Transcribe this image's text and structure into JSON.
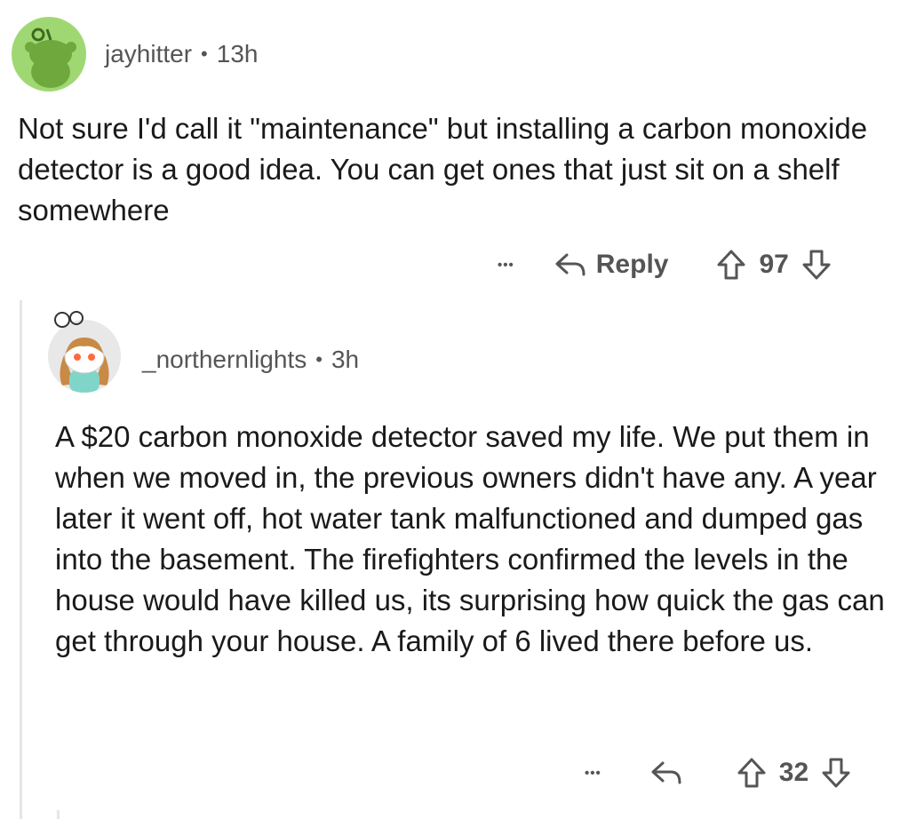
{
  "comments": [
    {
      "username": "jayhitter",
      "separator": "•",
      "age": "13h",
      "text": "Not sure I'd call it \"maintenance\" but installing a carbon monoxide detector is a good idea. You can get ones that just sit on a shelf somewhere",
      "more_label": "•••",
      "reply_label": "Reply",
      "score": "97",
      "avatar_color": "#9fd873"
    },
    {
      "username": "_northernlights",
      "separator": "•",
      "age": "3h",
      "text": "A $20 carbon monoxide detector saved my life. We put them in when we moved in, the previous owners didn't have any. A year later it went off, hot water tank malfunctioned and dumped gas into the basement. The firefighters confirmed the levels in the house would have killed us, its surprising how quick the gas can get through your house. A family of 6 lived there before us.",
      "more_label": "•••",
      "score": "32",
      "avatar_color": "#e8e8e8"
    }
  ],
  "colors": {
    "meta": "#555555",
    "thread_line": "#e6e6e6",
    "text": "#1a1a1b"
  }
}
